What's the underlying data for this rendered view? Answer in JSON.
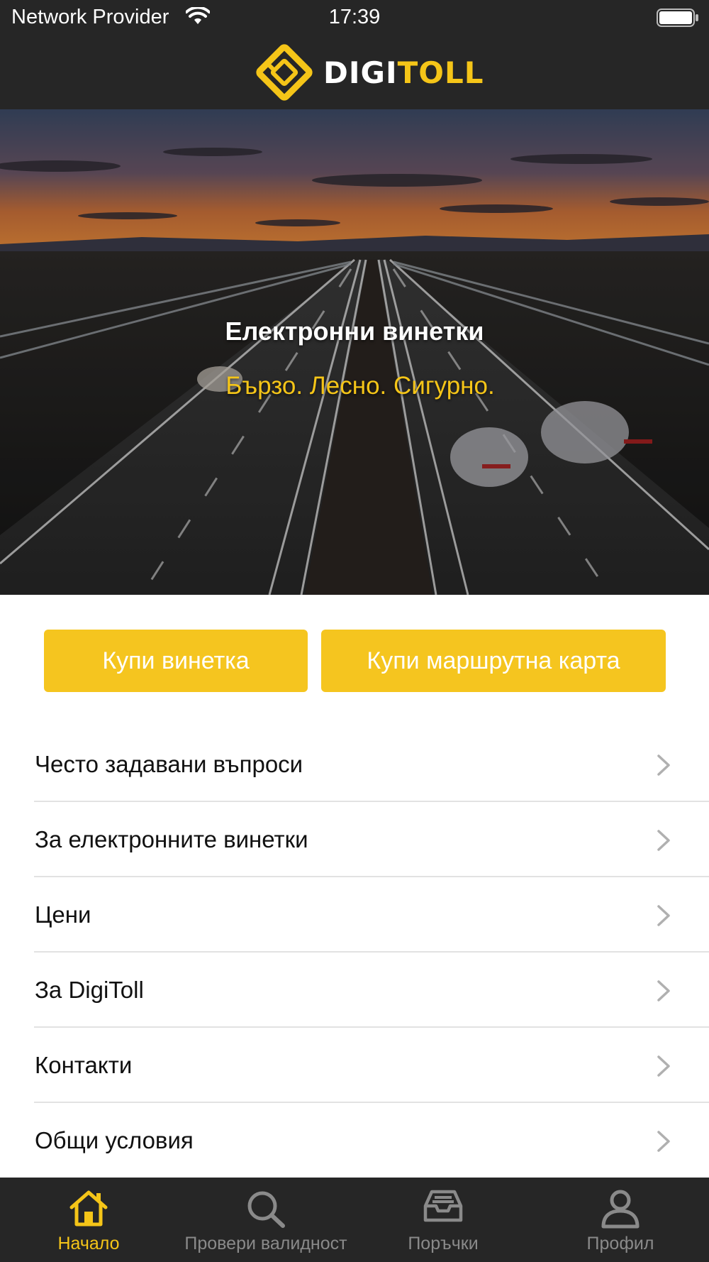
{
  "status_bar": {
    "carrier": "Network Provider",
    "time": "17:39"
  },
  "header": {
    "logo_text_white": "DIGI",
    "logo_text_yellow": "TOLL"
  },
  "hero": {
    "title": "Електронни винетки",
    "subtitle": "Бързо. Лесно. Сигурно."
  },
  "actions": {
    "buy_vignette": "Купи винетка",
    "buy_route_card": "Купи маршрутна карта"
  },
  "menu": {
    "items": [
      {
        "label": "Често задавани въпроси"
      },
      {
        "label": "За електронните винетки"
      },
      {
        "label": "Цени"
      },
      {
        "label": "За DigiToll"
      },
      {
        "label": "Контакти"
      },
      {
        "label": "Общи условия"
      }
    ]
  },
  "tab_bar": {
    "tabs": [
      {
        "label": "Начало",
        "icon": "home-icon",
        "active": true
      },
      {
        "label": "Провери валидност",
        "icon": "search-icon",
        "active": false
      },
      {
        "label": "Поръчки",
        "icon": "inbox-icon",
        "active": false
      },
      {
        "label": "Профил",
        "icon": "person-icon",
        "active": false
      }
    ]
  },
  "colors": {
    "brand_yellow": "#f5c518",
    "dark_bar": "#262626",
    "inactive_tab": "#8a8a8a"
  }
}
